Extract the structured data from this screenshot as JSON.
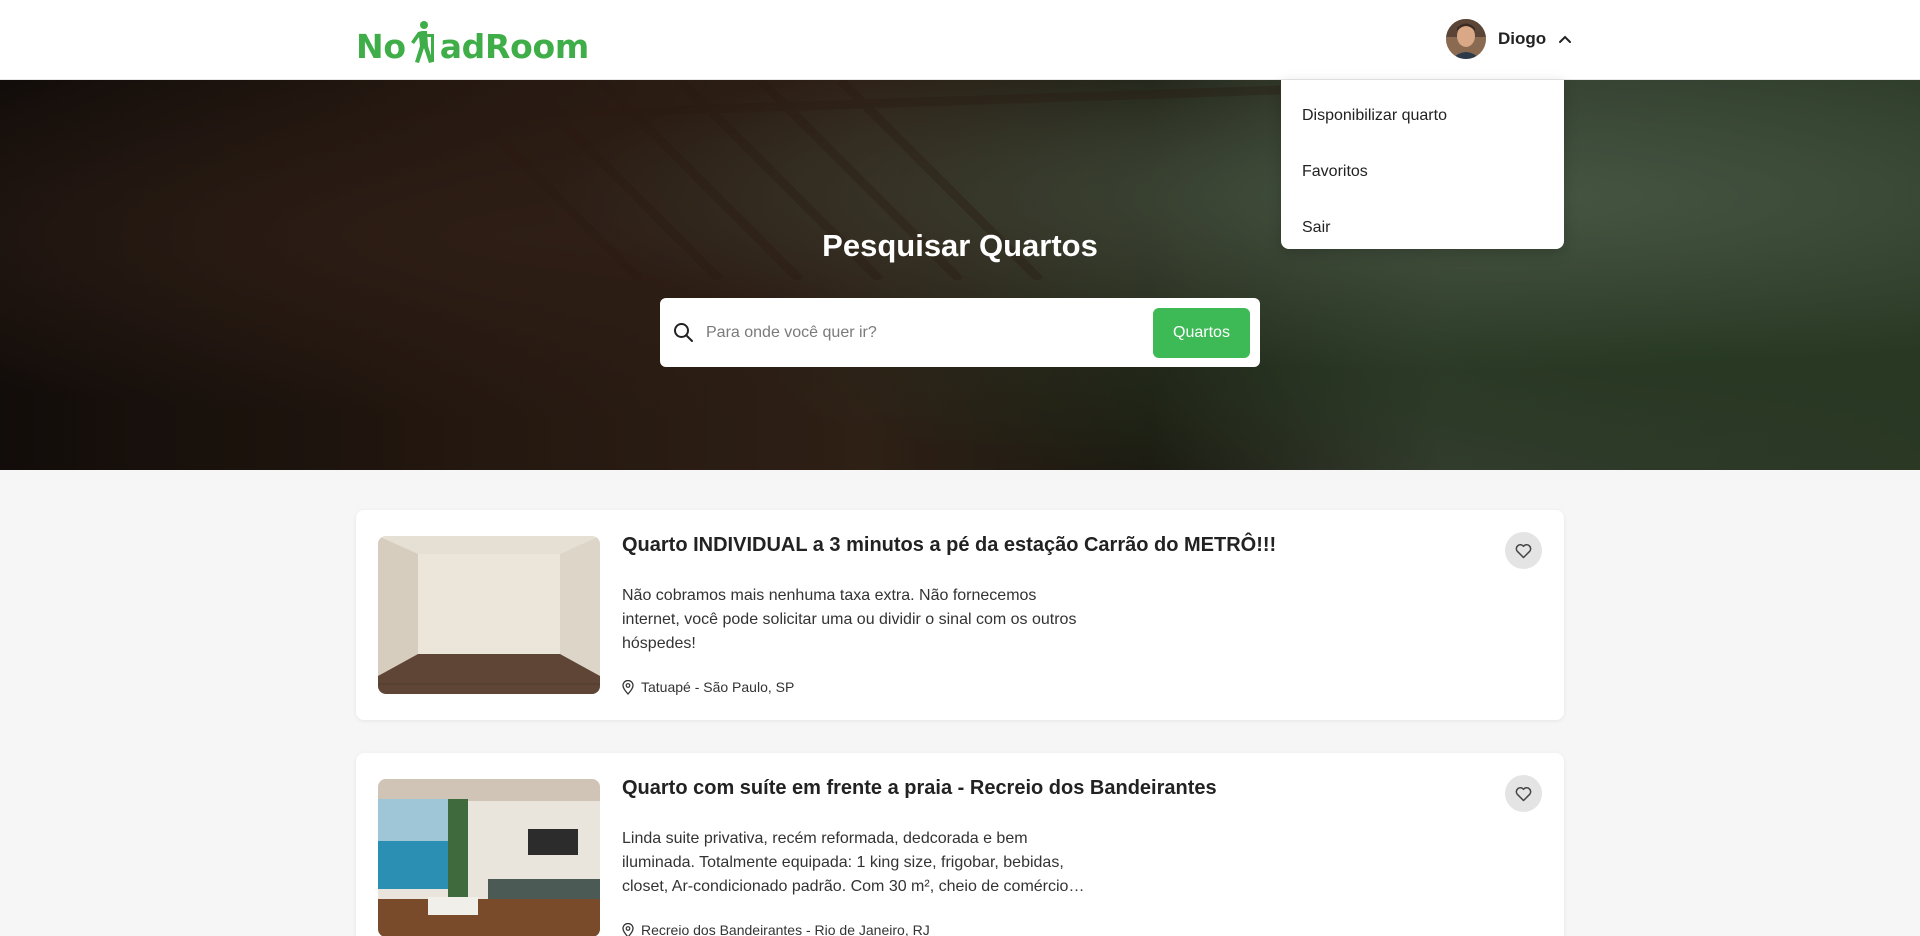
{
  "header": {
    "logo_text_before": "No",
    "logo_text_after": "adRoom",
    "user": {
      "name": "Diogo",
      "avatar_icon": "avatar-photo"
    }
  },
  "dropdown": {
    "items": [
      {
        "label": "Disponibilizar quarto"
      },
      {
        "label": "Favoritos"
      },
      {
        "label": "Sair"
      }
    ]
  },
  "hero": {
    "title": "Pesquisar Quartos",
    "search": {
      "placeholder": "Para onde você quer ir?",
      "value": "",
      "button_label": "Quartos"
    }
  },
  "listings": [
    {
      "title": "Quarto INDIVIDUAL a 3 minutos a pé da estação Carrão do METRÔ!!!",
      "description": "Não cobramos mais nenhuma taxa extra. Não fornecemos internet, você pode solicitar uma ou dividir o sinal com os outros hóspedes!",
      "location": "Tatuapé - São Paulo, SP"
    },
    {
      "title": "Quarto com suíte em frente a praia - Recreio dos Bandeirantes",
      "description": "Linda suite privativa, recém reformada, dedcorada e bem iluminada. Totalmente equipada: 1 king size, frigobar, bebidas, closet, Ar-condicionado padrão. Com 30 m², cheio de comércio…",
      "location": "Recreio dos Bandeirantes - Rio de Janeiro, RJ"
    }
  ],
  "colors": {
    "brand_green": "#3fae48",
    "button_green": "#3dba56"
  }
}
